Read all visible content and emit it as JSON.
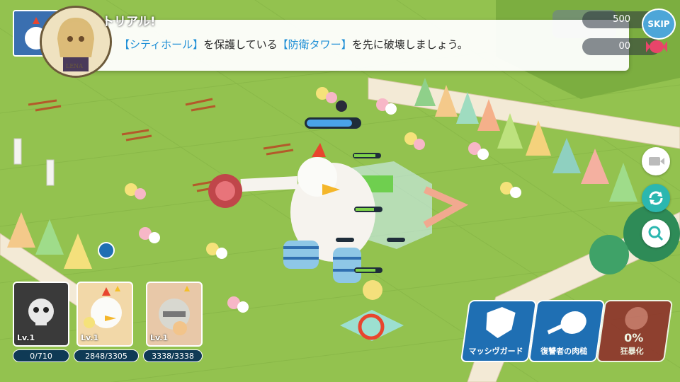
{
  "dialog": {
    "title": "トリアル!",
    "text_prefix": "",
    "hl1": "【シティホール】",
    "text_mid": "を保護している",
    "hl2": "【防衛タワー】",
    "text_suffix": "を先に破壊しましょう。",
    "portrait_name": "LENA"
  },
  "resources": {
    "gold": "500",
    "candy": "00"
  },
  "buttons": {
    "skip": "SKIP"
  },
  "units": [
    {
      "level": "Lv.1",
      "hp": "0/710",
      "status": "defeated"
    },
    {
      "level": "Lv.1",
      "hp": "2848/3305",
      "status": "active"
    },
    {
      "level": "Lv.1",
      "hp": "3338/3338",
      "status": "active"
    }
  ],
  "skills": [
    {
      "label": "マッシヴガード",
      "color": "#1f6fb3"
    },
    {
      "label": "復讐者の肉槌",
      "color": "#1f6fb3"
    },
    {
      "label": "狂暴化",
      "percent": "0%",
      "color": "#8e2a2a"
    }
  ],
  "colors": {
    "grass": "#8fbf4a",
    "accent_blue": "#1f8fd6",
    "wall": "#f3ead6"
  }
}
